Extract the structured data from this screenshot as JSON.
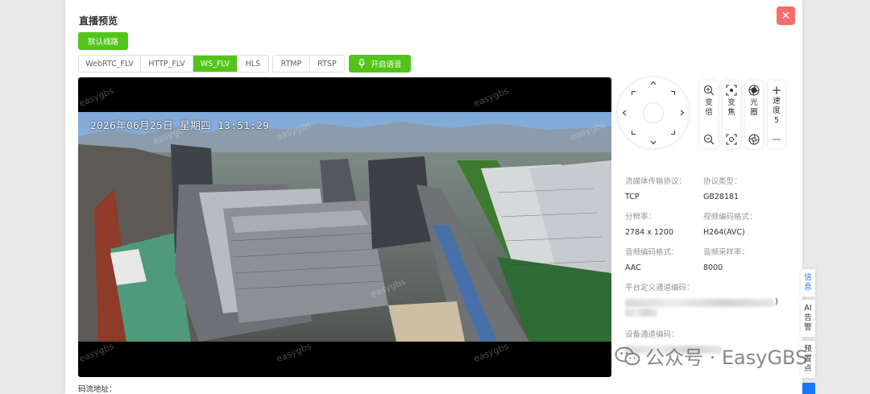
{
  "dialog": {
    "title": "直播预览",
    "close_glyph": "✕",
    "route_button": "默认线路"
  },
  "tabs": {
    "group1": [
      {
        "label": "WebRTC_FLV",
        "active": false
      },
      {
        "label": "HTTP_FLV",
        "active": false
      },
      {
        "label": "WS_FLV",
        "active": true
      },
      {
        "label": "HLS",
        "active": false
      }
    ],
    "group2": [
      {
        "label": "RTMP",
        "active": false
      },
      {
        "label": "RTSP",
        "active": false
      }
    ],
    "voice_button": "开启语音"
  },
  "player": {
    "osd_datetime": "2026年06月25日 星期四 13:51:29",
    "watermark_text": "easygbs"
  },
  "stream": {
    "label": "码流地址："
  },
  "controls": {
    "zoom_label": "变倍",
    "focus_label": "变焦",
    "iris_label": "光圈",
    "speed_label": "速度",
    "speed_value": "5",
    "plus_glyph": "+",
    "minus_glyph": "—"
  },
  "info": {
    "transport_label": "流媒体传输协议：",
    "transport_value": "TCP",
    "protocol_label": "协议类型：",
    "protocol_value": "GB28181",
    "resolution_label": "分辨率：",
    "resolution_value": "2784 x 1200",
    "video_codec_label": "视频编码格式：",
    "video_codec_value": "H264(AVC)",
    "audio_codec_label": "音频编码格式：",
    "audio_codec_value": "AAC",
    "audio_rate_label": "音频采样率：",
    "audio_rate_value": "8000",
    "platform_channel_label": "平台定义通道编码：",
    "platform_channel_tail": ")",
    "device_channel_label": "设备通道编码："
  },
  "side_tabs": {
    "info": "信息",
    "ai_alarm": "AI告警",
    "preset": "预置点"
  },
  "overlay": {
    "wechat_watermark": "公众号 · EasyGBS"
  },
  "colors": {
    "primary_green": "#52c41a",
    "close_red": "#f56c6c",
    "active_blue": "#1677ff"
  }
}
